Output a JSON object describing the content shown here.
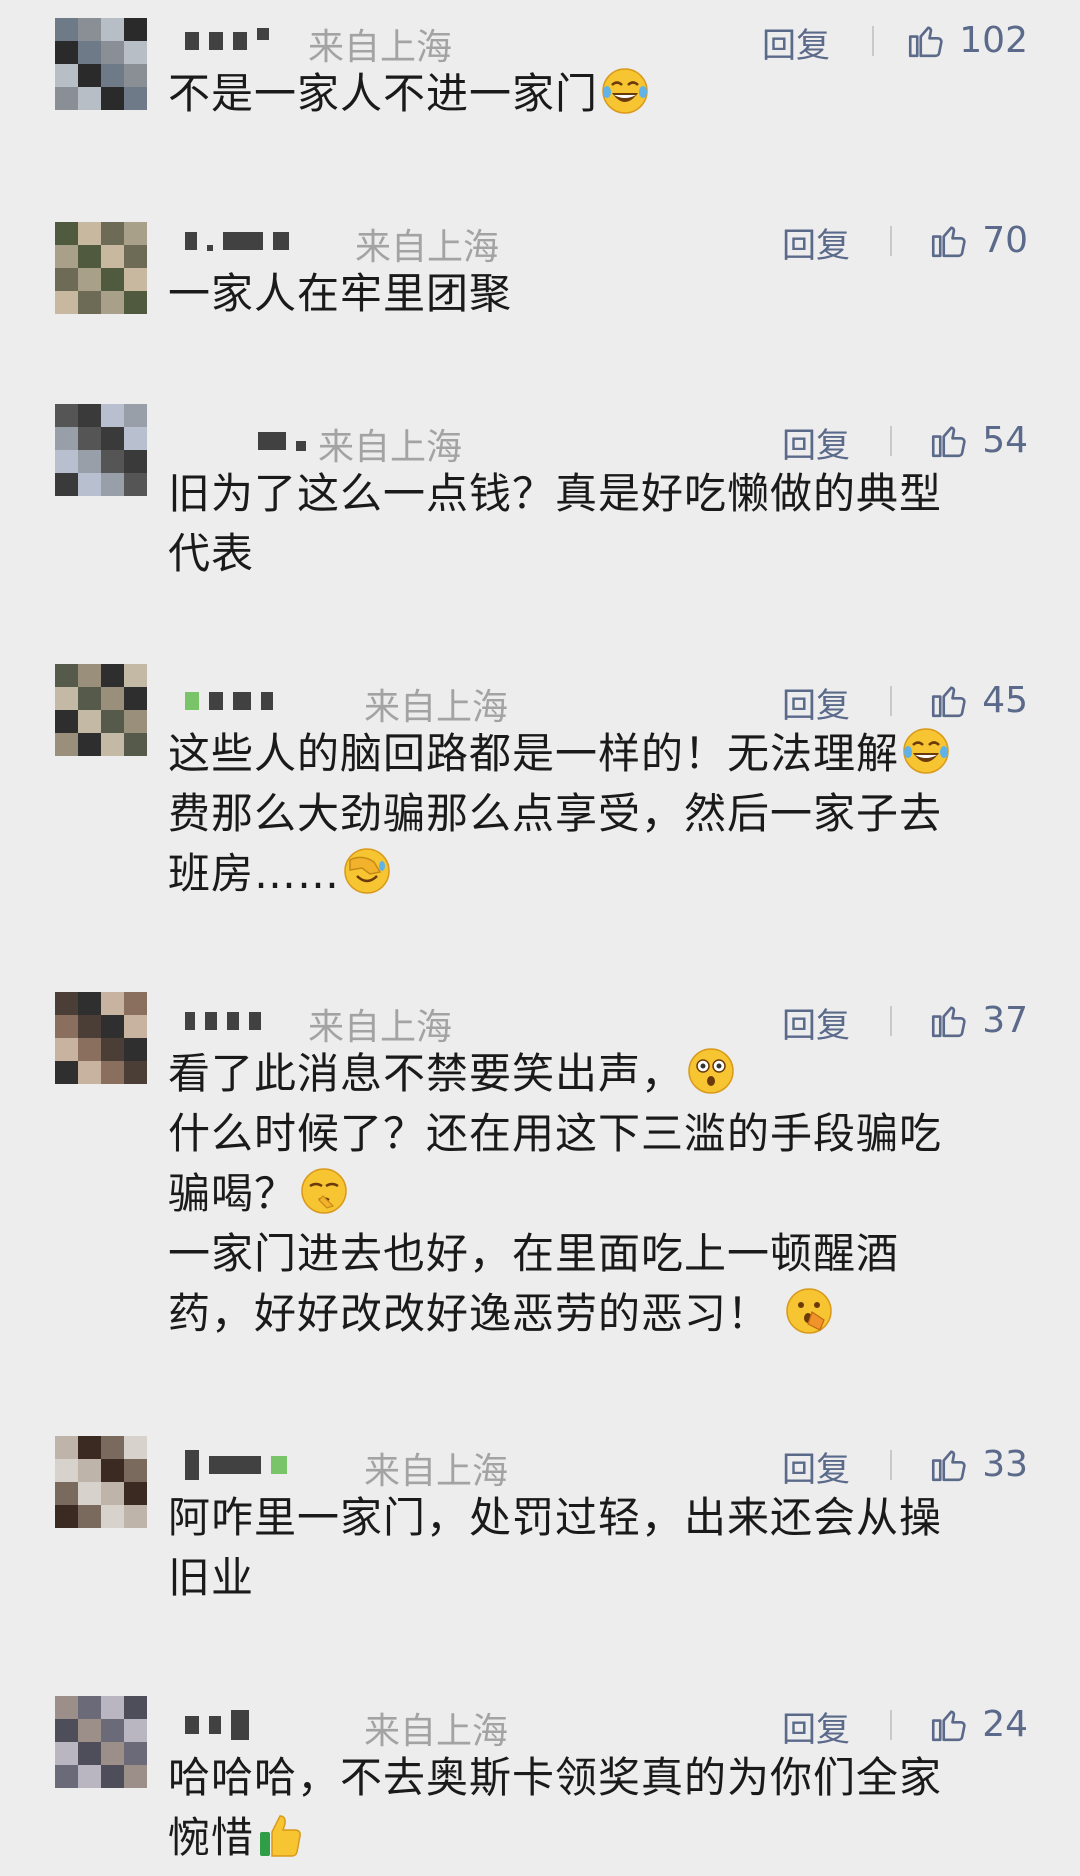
{
  "colors": {
    "background": "#ededed",
    "text": "#1a1a1a",
    "meta": "#a3a3a3",
    "accent": "#5b6a8a"
  },
  "comments": [
    {
      "location": "来自上海",
      "reply_label": "回复",
      "likes": "102",
      "lines": [
        [
          "不是一家人不进一家门",
          "laughing-tears-emoji"
        ]
      ]
    },
    {
      "location": "来自上海",
      "reply_label": "回复",
      "likes": "70",
      "lines": [
        [
          "一家人在牢里团聚",
          ""
        ]
      ]
    },
    {
      "location": "来自上海",
      "reply_label": "回复",
      "likes": "54",
      "lines": [
        [
          "旧为了这么一点钱？真是好吃懒做的典型",
          ""
        ],
        [
          "代表",
          ""
        ]
      ]
    },
    {
      "location": "来自上海",
      "reply_label": "回复",
      "likes": "45",
      "lines": [
        [
          "这些人的脑回路都是一样的！无法理解",
          "laughing-tears-emoji"
        ],
        [
          "费那么大劲骗那么点享受，然后一家子去",
          ""
        ],
        [
          "班房……",
          "facepalm-emoji"
        ]
      ]
    },
    {
      "location": "来自上海",
      "reply_label": "回复",
      "likes": "37",
      "lines": [
        [
          "看了此消息不禁要笑出声，",
          "shocked-emoji"
        ],
        [
          "什么时候了？还在用这下三滥的手段骗吃",
          ""
        ],
        [
          "骗喝？",
          "smirk-emoji"
        ],
        [
          "一家门进去也好，在里面吃上一顿醒酒",
          ""
        ],
        [
          "药，好好改改好逸恶劳的恶习！",
          "shush-emoji"
        ]
      ]
    },
    {
      "location": "来自上海",
      "reply_label": "回复",
      "likes": "33",
      "lines": [
        [
          "阿咋里一家门，处罚过轻，出来还会从操",
          ""
        ],
        [
          "旧业",
          ""
        ]
      ]
    },
    {
      "location": "来自上海",
      "reply_label": "回复",
      "likes": "24",
      "lines": [
        [
          "哈哈哈，不去奥斯卡领奖真的为你们全家",
          ""
        ],
        [
          "惋惜",
          "thumbs-up-emoji"
        ]
      ]
    }
  ]
}
